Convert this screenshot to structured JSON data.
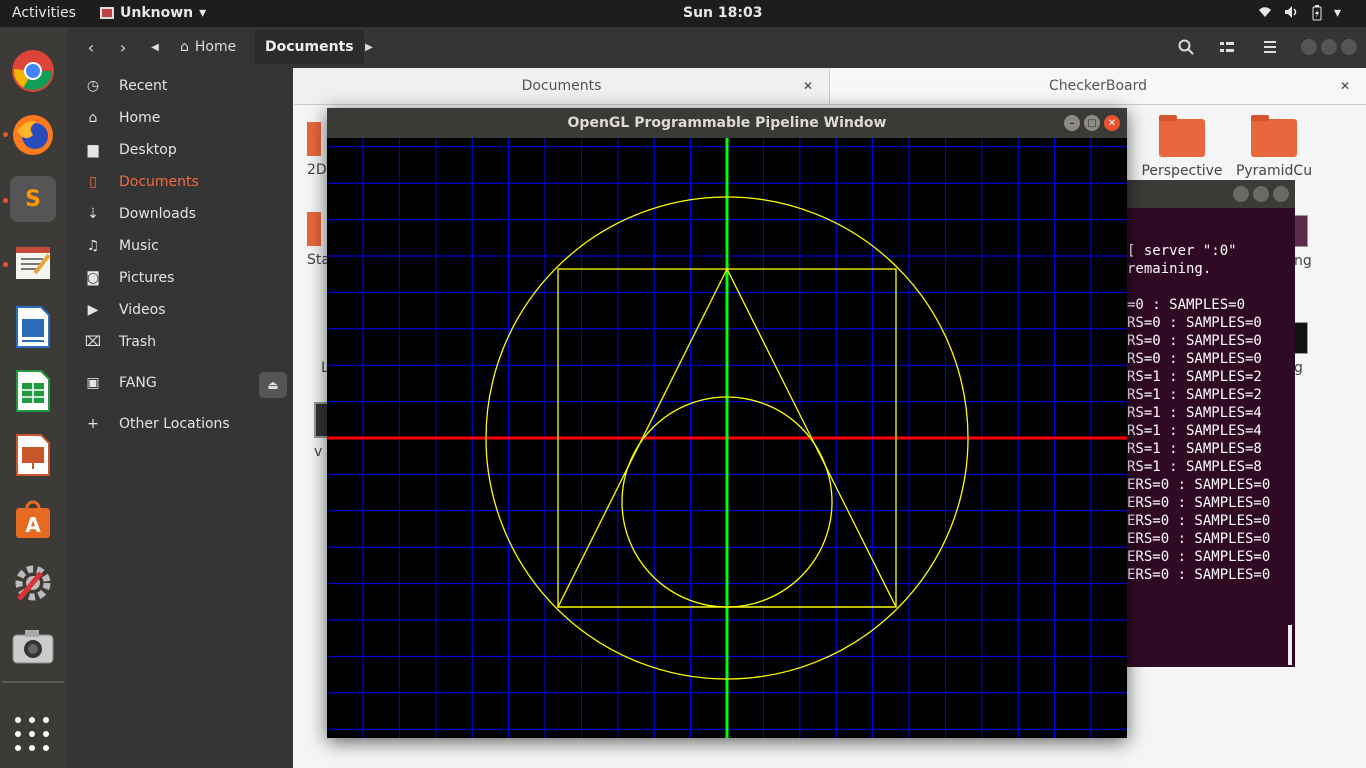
{
  "topbar": {
    "activities": "Activities",
    "app_name": "Unknown",
    "clock": "Sun 18:03"
  },
  "dock": {
    "apps": [
      "chrome-icon",
      "firefox-icon",
      "sublime-text-icon",
      "text-editor-icon",
      "writer-icon",
      "calc-icon",
      "impress-icon",
      "software-center-icon",
      "settings-icon",
      "camera-icon"
    ]
  },
  "files": {
    "breadcrumb": {
      "home": "Home",
      "current": "Documents"
    },
    "sidebar": {
      "items": [
        {
          "label": "Recent",
          "icon": "clock-icon"
        },
        {
          "label": "Home",
          "icon": "home-icon"
        },
        {
          "label": "Desktop",
          "icon": "folder-icon"
        },
        {
          "label": "Documents",
          "icon": "document-icon"
        },
        {
          "label": "Downloads",
          "icon": "download-icon"
        },
        {
          "label": "Music",
          "icon": "music-icon"
        },
        {
          "label": "Pictures",
          "icon": "camera-icon"
        },
        {
          "label": "Videos",
          "icon": "video-icon"
        },
        {
          "label": "Trash",
          "icon": "trash-icon"
        },
        {
          "label": "FANG",
          "icon": "drive-icon"
        },
        {
          "label": "Other Locations",
          "icon": "plus-icon"
        }
      ]
    },
    "tabs": [
      {
        "label": "Documents"
      },
      {
        "label": "CheckerBoard"
      }
    ],
    "partial_items": [
      "2D",
      "Sta",
      "L",
      "v"
    ],
    "folders": [
      {
        "label": "Perspective"
      },
      {
        "label": "PyramidCu"
      }
    ],
    "right_edge": [
      "ng",
      "g"
    ]
  },
  "terminal": {
    "lines": [
      "[ server \":0\"",
      "remaining.",
      "",
      "=0 : SAMPLES=0",
      "RS=0 : SAMPLES=0",
      "RS=0 : SAMPLES=0",
      "RS=0 : SAMPLES=0",
      "RS=1 : SAMPLES=2",
      "RS=1 : SAMPLES=2",
      "RS=1 : SAMPLES=4",
      "RS=1 : SAMPLES=4",
      "RS=1 : SAMPLES=8",
      "RS=1 : SAMPLES=8",
      "ERS=0 : SAMPLES=0",
      "ERS=0 : SAMPLES=0",
      "ERS=0 : SAMPLES=0",
      "ERS=0 : SAMPLES=0",
      "ERS=0 : SAMPLES=0",
      "ERS=0 : SAMPLES=0"
    ]
  },
  "opengl": {
    "title": "OpenGL Programmable Pipeline Window",
    "colors": {
      "grid": "#0000ff",
      "x_axis": "#ff0000",
      "y_axis": "#00ff00",
      "shapes": "#ffff00"
    }
  }
}
